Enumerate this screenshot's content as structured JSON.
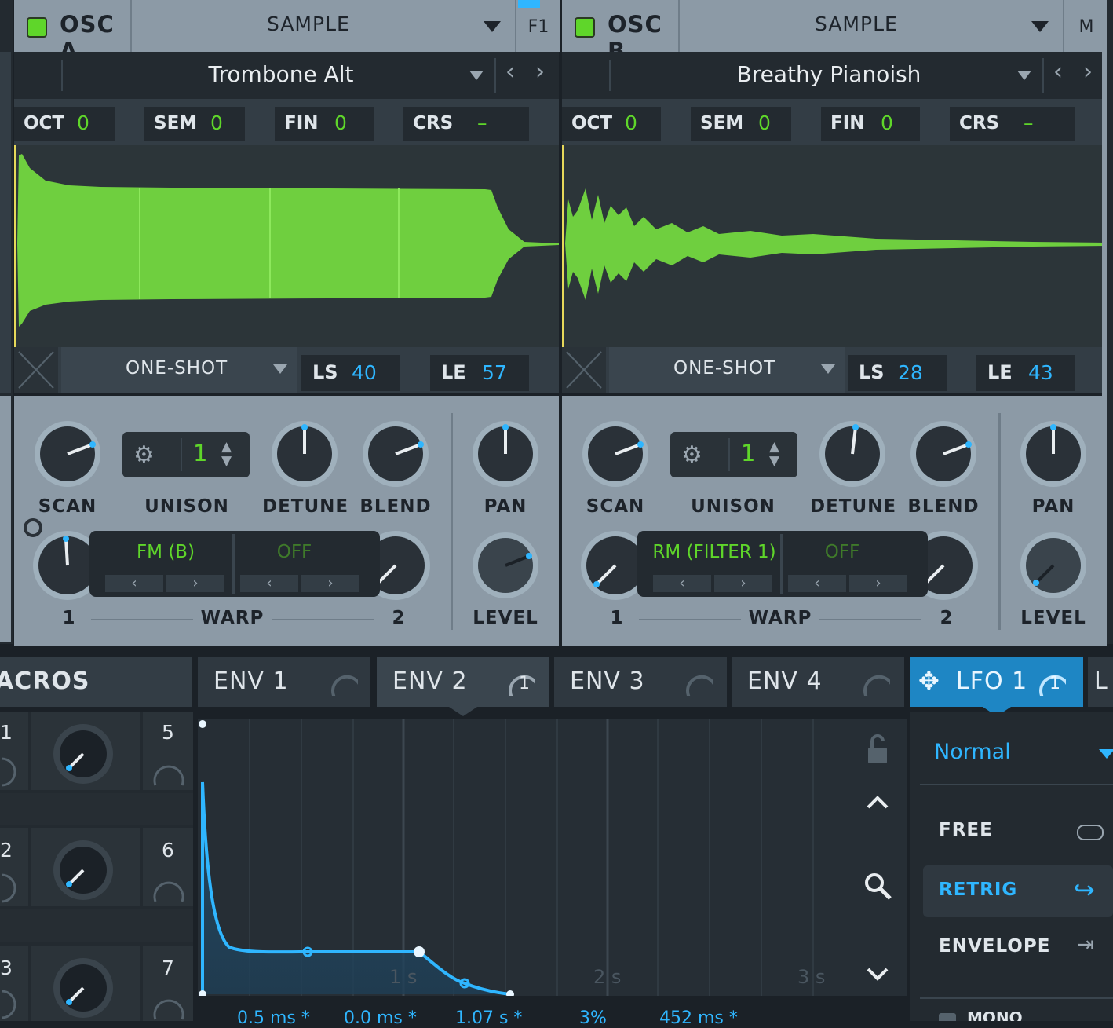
{
  "osc_a": {
    "title": "OSC A",
    "mode": "SAMPLE",
    "side_tab": "F1",
    "sample_name": "Trombone Alt",
    "params": [
      {
        "label": "OCT",
        "value": "0"
      },
      {
        "label": "SEM",
        "value": "0"
      },
      {
        "label": "FIN",
        "value": "0"
      },
      {
        "label": "CRS",
        "value": "–"
      }
    ],
    "loop_mode": "ONE-SHOT",
    "ls_label": "LS",
    "ls_value": "40",
    "le_label": "LE",
    "le_value": "57",
    "knobs": {
      "scan": "SCAN",
      "unison": "UNISON",
      "detune": "DETUNE",
      "blend": "BLEND",
      "pan": "PAN",
      "level": "LEVEL"
    },
    "unison_value": "1",
    "warp1": "FM (B)",
    "warp2": "OFF",
    "warp_label": "WARP",
    "warp_knob1": "1",
    "warp_knob2": "2"
  },
  "osc_b": {
    "title": "OSC B",
    "mode": "SAMPLE",
    "side_tab": "M",
    "sample_name": "Breathy Pianoish",
    "params": [
      {
        "label": "OCT",
        "value": "0"
      },
      {
        "label": "SEM",
        "value": "0"
      },
      {
        "label": "FIN",
        "value": "0"
      },
      {
        "label": "CRS",
        "value": "–"
      }
    ],
    "loop_mode": "ONE-SHOT",
    "ls_label": "LS",
    "ls_value": "28",
    "le_label": "LE",
    "le_value": "43",
    "knobs": {
      "scan": "SCAN",
      "unison": "UNISON",
      "detune": "DETUNE",
      "blend": "BLEND",
      "pan": "PAN",
      "level": "LEVEL"
    },
    "unison_value": "1",
    "warp1": "RM (FILTER 1)",
    "warp2": "OFF",
    "warp_label": "WARP",
    "warp_knob1": "1",
    "warp_knob2": "2"
  },
  "tabs": {
    "macros": "ACROS",
    "env1": "ENV 1",
    "env2": "ENV 2",
    "env2_badge": "1",
    "env3": "ENV 3",
    "env4": "ENV 4",
    "lfo1": "LFO 1",
    "lfo1_badge": "1",
    "next": "L"
  },
  "macros": {
    "numbers": [
      "1",
      "5",
      "2",
      "6",
      "3",
      "7"
    ]
  },
  "envelope": {
    "time_labels": [
      "1 s",
      "2 s",
      "3 s"
    ],
    "footer_values": [
      "0.5 ms *",
      "0.0 ms *",
      "1.07 s *",
      "3%",
      "452 ms *"
    ]
  },
  "lfo": {
    "mode": "Normal",
    "free": "FREE",
    "retrig": "RETRIG",
    "envelope": "ENVELOPE",
    "mono": "MONO"
  },
  "colors": {
    "accent_green": "#5fd62a",
    "accent_blue": "#2fb6ff",
    "panel": "#8c9aa6",
    "dark": "#1b2127"
  }
}
